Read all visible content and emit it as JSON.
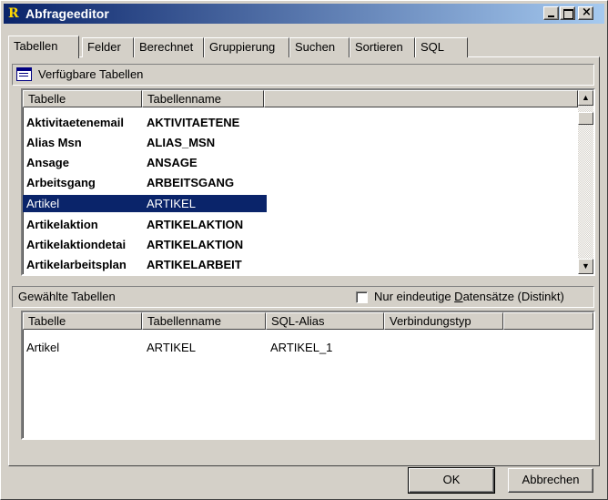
{
  "window": {
    "title": "Abfrageeditor",
    "icon_letter": "R"
  },
  "tabs": [
    {
      "label": "Tabellen",
      "active": true
    },
    {
      "label": "Felder"
    },
    {
      "label": "Berechnet"
    },
    {
      "label": "Gruppierung"
    },
    {
      "label": "Suchen"
    },
    {
      "label": "Sortieren"
    },
    {
      "label": "SQL"
    }
  ],
  "available": {
    "title": "Verfügbare Tabellen",
    "columns": [
      "Tabelle",
      "Tabellenname"
    ],
    "rows": [
      {
        "table": "Aktivitaetenemail",
        "name": "AKTIVITAETENE"
      },
      {
        "table": "Alias Msn",
        "name": "ALIAS_MSN"
      },
      {
        "table": "Ansage",
        "name": "ANSAGE"
      },
      {
        "table": "Arbeitsgang",
        "name": "ARBEITSGANG"
      },
      {
        "table": "Artikel",
        "name": "ARTIKEL",
        "selected": true
      },
      {
        "table": "Artikelaktion",
        "name": "ARTIKELAKTION"
      },
      {
        "table": "Artikelaktiondetai",
        "name": "ARTIKELAKTION"
      },
      {
        "table": "Artikelarbeitsplan",
        "name": "ARTIKELARBEIT"
      }
    ]
  },
  "chosen": {
    "title": "Gewählte Tabellen",
    "distinct_label_pre": "Nur eindeutige ",
    "distinct_label_u": "D",
    "distinct_label_post": "atensätze (Distinkt)",
    "distinct_checked": false,
    "columns": [
      "Tabelle",
      "Tabellenname",
      "SQL-Alias",
      "Verbindungstyp"
    ],
    "rows": [
      {
        "table": "Artikel",
        "name": "ARTIKEL",
        "alias": "ARTIKEL_1",
        "join": ""
      }
    ]
  },
  "buttons": {
    "ok": "OK",
    "cancel": "Abbrechen"
  }
}
